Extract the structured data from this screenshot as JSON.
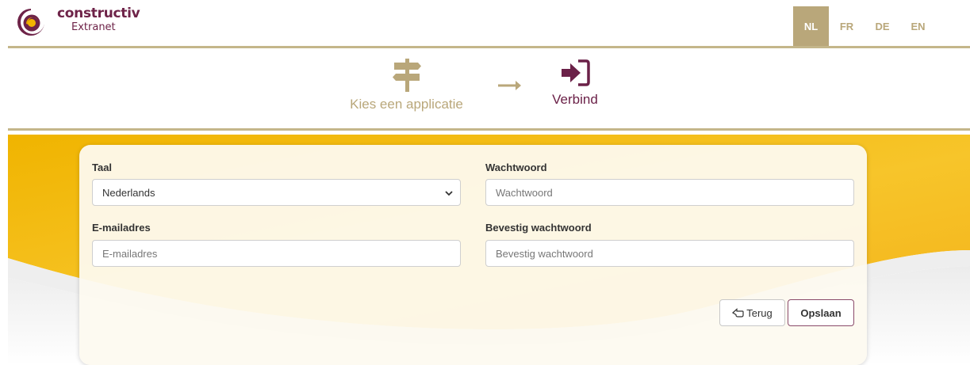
{
  "header": {
    "brand_name": "constructiv",
    "brand_sub": "Extranet",
    "languages": [
      "NL",
      "FR",
      "DE",
      "EN"
    ],
    "active_language": "NL"
  },
  "steps": {
    "step1_label": "Kies een applicatie",
    "step2_label": "Verbind"
  },
  "form": {
    "language_label": "Taal",
    "language_value": "Nederlands",
    "email_label": "E-mailadres",
    "email_placeholder": "E-mailadres",
    "password_label": "Wachtwoord",
    "password_placeholder": "Wachtwoord",
    "confirm_label": "Bevestig wachtwoord",
    "confirm_placeholder": "Bevestig wachtwoord",
    "back_label": "Terug",
    "save_label": "Opslaan"
  },
  "colors": {
    "brand_purple": "#6e2348",
    "gold": "#b9a77a",
    "band_yellow": "#f2b400"
  }
}
